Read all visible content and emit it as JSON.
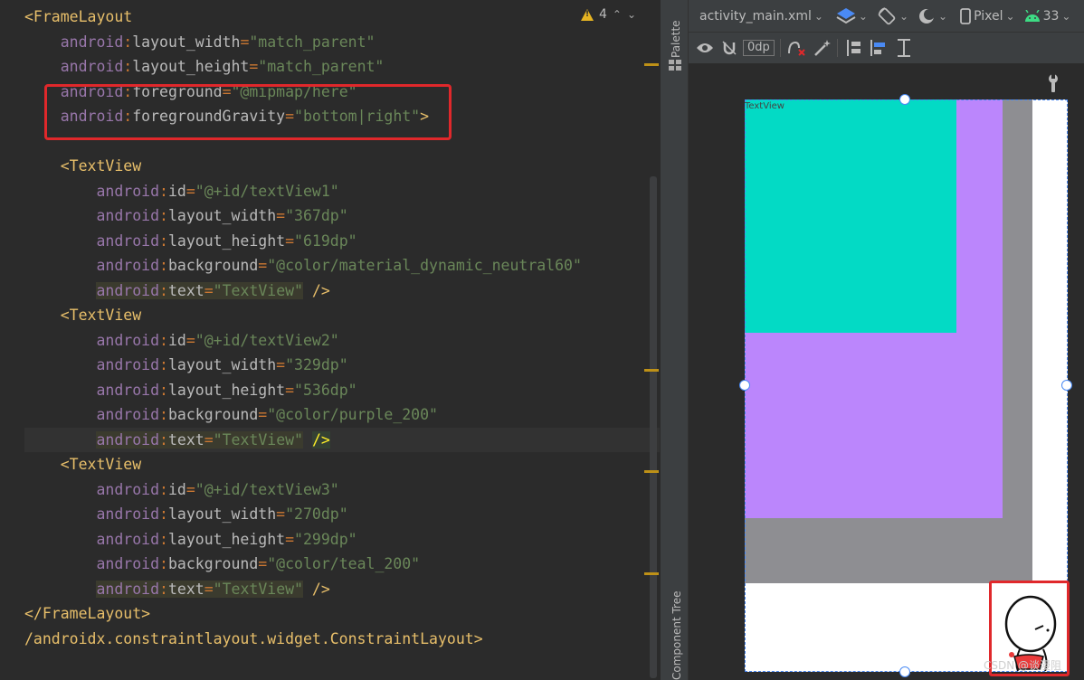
{
  "editor": {
    "inspection": {
      "warning_count": "4"
    },
    "lines": [
      {
        "segments": [
          [
            "t",
            "<FrameLayout"
          ]
        ]
      },
      {
        "segments": [
          [
            "ns",
            "    android"
          ],
          [
            "pl",
            ":"
          ],
          [
            "at",
            "layout_width"
          ],
          [
            "pl",
            "="
          ],
          [
            "v",
            "\"match_parent\""
          ]
        ]
      },
      {
        "segments": [
          [
            "ns",
            "    android"
          ],
          [
            "pl",
            ":"
          ],
          [
            "at",
            "layout_height"
          ],
          [
            "pl",
            "="
          ],
          [
            "v",
            "\"match_parent\""
          ]
        ]
      },
      {
        "segments": [
          [
            "ns",
            "    android"
          ],
          [
            "pl",
            ":"
          ],
          [
            "at",
            "foreground"
          ],
          [
            "pl",
            "="
          ],
          [
            "v",
            "\"@mipmap/here\""
          ]
        ]
      },
      {
        "segments": [
          [
            "ns",
            "    android"
          ],
          [
            "pl",
            ":"
          ],
          [
            "at",
            "foregroundGravity"
          ],
          [
            "pl",
            "="
          ],
          [
            "v",
            "\"bottom|right\""
          ],
          [
            "t",
            ">"
          ]
        ]
      },
      {
        "segments": []
      },
      {
        "segments": [
          [
            "t",
            "    <TextView"
          ]
        ]
      },
      {
        "segments": [
          [
            "ns",
            "        android"
          ],
          [
            "pl",
            ":"
          ],
          [
            "at",
            "id"
          ],
          [
            "pl",
            "="
          ],
          [
            "v",
            "\"@+id/textView1\""
          ]
        ]
      },
      {
        "segments": [
          [
            "ns",
            "        android"
          ],
          [
            "pl",
            ":"
          ],
          [
            "at",
            "layout_width"
          ],
          [
            "pl",
            "="
          ],
          [
            "v",
            "\"367dp\""
          ]
        ]
      },
      {
        "segments": [
          [
            "ns",
            "        android"
          ],
          [
            "pl",
            ":"
          ],
          [
            "at",
            "layout_height"
          ],
          [
            "pl",
            "="
          ],
          [
            "v",
            "\"619dp\""
          ]
        ]
      },
      {
        "segments": [
          [
            "ns",
            "        android"
          ],
          [
            "pl",
            ":"
          ],
          [
            "at",
            "background"
          ],
          [
            "pl",
            "="
          ],
          [
            "v",
            "\"@color/material_dynamic_neutral60\""
          ]
        ]
      },
      {
        "segments": [
          [
            "",
            "        "
          ],
          [
            "ns hl",
            "android"
          ],
          [
            "pl hl",
            ":"
          ],
          [
            "at hl",
            "text"
          ],
          [
            "pl hl",
            "="
          ],
          [
            "v hl",
            "\"TextView\""
          ],
          [
            "t",
            " />"
          ]
        ]
      },
      {
        "segments": [
          [
            "t",
            "    <TextView"
          ]
        ]
      },
      {
        "segments": [
          [
            "ns",
            "        android"
          ],
          [
            "pl",
            ":"
          ],
          [
            "at",
            "id"
          ],
          [
            "pl",
            "="
          ],
          [
            "v",
            "\"@+id/textView2\""
          ]
        ]
      },
      {
        "segments": [
          [
            "ns",
            "        android"
          ],
          [
            "pl",
            ":"
          ],
          [
            "at",
            "layout_width"
          ],
          [
            "pl",
            "="
          ],
          [
            "v",
            "\"329dp\""
          ]
        ]
      },
      {
        "segments": [
          [
            "ns",
            "        android"
          ],
          [
            "pl",
            ":"
          ],
          [
            "at",
            "layout_height"
          ],
          [
            "pl",
            "="
          ],
          [
            "v",
            "\"536dp\""
          ]
        ]
      },
      {
        "segments": [
          [
            "ns",
            "        android"
          ],
          [
            "pl",
            ":"
          ],
          [
            "at",
            "background"
          ],
          [
            "pl",
            "="
          ],
          [
            "v",
            "\"@color/purple_200\""
          ]
        ]
      },
      {
        "segments": [
          [
            "",
            "        "
          ],
          [
            "ns hl",
            "android"
          ],
          [
            "pl hl",
            ":"
          ],
          [
            "at hl",
            "text"
          ],
          [
            "pl hl",
            "="
          ],
          [
            "v hl",
            "\"TextView\""
          ],
          [
            "t",
            " "
          ],
          [
            "hl-strong",
            "/>"
          ]
        ],
        "current": true
      },
      {
        "segments": [
          [
            "t",
            "    <TextView"
          ]
        ]
      },
      {
        "segments": [
          [
            "ns",
            "        android"
          ],
          [
            "pl",
            ":"
          ],
          [
            "at",
            "id"
          ],
          [
            "pl",
            "="
          ],
          [
            "v",
            "\"@+id/textView3\""
          ]
        ]
      },
      {
        "segments": [
          [
            "ns",
            "        android"
          ],
          [
            "pl",
            ":"
          ],
          [
            "at",
            "layout_width"
          ],
          [
            "pl",
            "="
          ],
          [
            "v",
            "\"270dp\""
          ]
        ]
      },
      {
        "segments": [
          [
            "ns",
            "        android"
          ],
          [
            "pl",
            ":"
          ],
          [
            "at",
            "layout_height"
          ],
          [
            "pl",
            "="
          ],
          [
            "v",
            "\"299dp\""
          ]
        ]
      },
      {
        "segments": [
          [
            "ns",
            "        android"
          ],
          [
            "pl",
            ":"
          ],
          [
            "at",
            "background"
          ],
          [
            "pl",
            "="
          ],
          [
            "v",
            "\"@color/teal_200\""
          ]
        ]
      },
      {
        "segments": [
          [
            "",
            "        "
          ],
          [
            "ns hl",
            "android"
          ],
          [
            "pl hl",
            ":"
          ],
          [
            "at hl",
            "text"
          ],
          [
            "pl hl",
            "="
          ],
          [
            "v hl",
            "\"TextView\""
          ],
          [
            "t",
            " />"
          ]
        ]
      },
      {
        "segments": [
          [
            "t",
            "</FrameLayout>"
          ]
        ]
      },
      {
        "segments": [
          [
            "t",
            "/androidx.constraintlayout.widget.ConstraintLayout>"
          ]
        ]
      }
    ]
  },
  "side_strip": {
    "palette_label": "Palette",
    "component_tree_label": "Component Tree"
  },
  "design": {
    "file_tab": "activity_main.xml",
    "device": "Pixel",
    "api_level": "33",
    "margin_value": "0dp",
    "preview_textview_label": "TextView",
    "colors": {
      "neutral60": "#8e8e92",
      "purple_200": "#bb86fc",
      "teal_200": "#03dac5"
    },
    "watermark": "CSDN @谈漫阻"
  }
}
